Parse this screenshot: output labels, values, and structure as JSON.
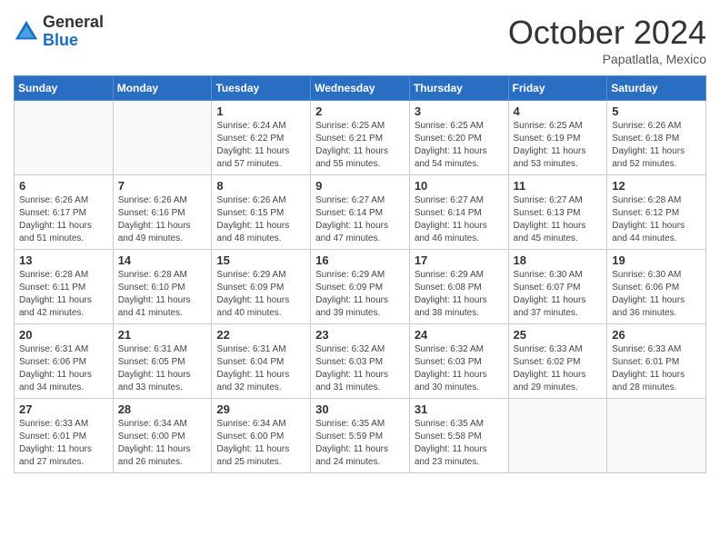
{
  "logo": {
    "general": "General",
    "blue": "Blue"
  },
  "title": {
    "month": "October 2024",
    "location": "Papatlatla, Mexico"
  },
  "headers": [
    "Sunday",
    "Monday",
    "Tuesday",
    "Wednesday",
    "Thursday",
    "Friday",
    "Saturday"
  ],
  "weeks": [
    [
      {
        "day": "",
        "info": ""
      },
      {
        "day": "",
        "info": ""
      },
      {
        "day": "1",
        "info": "Sunrise: 6:24 AM\nSunset: 6:22 PM\nDaylight: 11 hours and 57 minutes."
      },
      {
        "day": "2",
        "info": "Sunrise: 6:25 AM\nSunset: 6:21 PM\nDaylight: 11 hours and 55 minutes."
      },
      {
        "day": "3",
        "info": "Sunrise: 6:25 AM\nSunset: 6:20 PM\nDaylight: 11 hours and 54 minutes."
      },
      {
        "day": "4",
        "info": "Sunrise: 6:25 AM\nSunset: 6:19 PM\nDaylight: 11 hours and 53 minutes."
      },
      {
        "day": "5",
        "info": "Sunrise: 6:26 AM\nSunset: 6:18 PM\nDaylight: 11 hours and 52 minutes."
      }
    ],
    [
      {
        "day": "6",
        "info": "Sunrise: 6:26 AM\nSunset: 6:17 PM\nDaylight: 11 hours and 51 minutes."
      },
      {
        "day": "7",
        "info": "Sunrise: 6:26 AM\nSunset: 6:16 PM\nDaylight: 11 hours and 49 minutes."
      },
      {
        "day": "8",
        "info": "Sunrise: 6:26 AM\nSunset: 6:15 PM\nDaylight: 11 hours and 48 minutes."
      },
      {
        "day": "9",
        "info": "Sunrise: 6:27 AM\nSunset: 6:14 PM\nDaylight: 11 hours and 47 minutes."
      },
      {
        "day": "10",
        "info": "Sunrise: 6:27 AM\nSunset: 6:14 PM\nDaylight: 11 hours and 46 minutes."
      },
      {
        "day": "11",
        "info": "Sunrise: 6:27 AM\nSunset: 6:13 PM\nDaylight: 11 hours and 45 minutes."
      },
      {
        "day": "12",
        "info": "Sunrise: 6:28 AM\nSunset: 6:12 PM\nDaylight: 11 hours and 44 minutes."
      }
    ],
    [
      {
        "day": "13",
        "info": "Sunrise: 6:28 AM\nSunset: 6:11 PM\nDaylight: 11 hours and 42 minutes."
      },
      {
        "day": "14",
        "info": "Sunrise: 6:28 AM\nSunset: 6:10 PM\nDaylight: 11 hours and 41 minutes."
      },
      {
        "day": "15",
        "info": "Sunrise: 6:29 AM\nSunset: 6:09 PM\nDaylight: 11 hours and 40 minutes."
      },
      {
        "day": "16",
        "info": "Sunrise: 6:29 AM\nSunset: 6:09 PM\nDaylight: 11 hours and 39 minutes."
      },
      {
        "day": "17",
        "info": "Sunrise: 6:29 AM\nSunset: 6:08 PM\nDaylight: 11 hours and 38 minutes."
      },
      {
        "day": "18",
        "info": "Sunrise: 6:30 AM\nSunset: 6:07 PM\nDaylight: 11 hours and 37 minutes."
      },
      {
        "day": "19",
        "info": "Sunrise: 6:30 AM\nSunset: 6:06 PM\nDaylight: 11 hours and 36 minutes."
      }
    ],
    [
      {
        "day": "20",
        "info": "Sunrise: 6:31 AM\nSunset: 6:06 PM\nDaylight: 11 hours and 34 minutes."
      },
      {
        "day": "21",
        "info": "Sunrise: 6:31 AM\nSunset: 6:05 PM\nDaylight: 11 hours and 33 minutes."
      },
      {
        "day": "22",
        "info": "Sunrise: 6:31 AM\nSunset: 6:04 PM\nDaylight: 11 hours and 32 minutes."
      },
      {
        "day": "23",
        "info": "Sunrise: 6:32 AM\nSunset: 6:03 PM\nDaylight: 11 hours and 31 minutes."
      },
      {
        "day": "24",
        "info": "Sunrise: 6:32 AM\nSunset: 6:03 PM\nDaylight: 11 hours and 30 minutes."
      },
      {
        "day": "25",
        "info": "Sunrise: 6:33 AM\nSunset: 6:02 PM\nDaylight: 11 hours and 29 minutes."
      },
      {
        "day": "26",
        "info": "Sunrise: 6:33 AM\nSunset: 6:01 PM\nDaylight: 11 hours and 28 minutes."
      }
    ],
    [
      {
        "day": "27",
        "info": "Sunrise: 6:33 AM\nSunset: 6:01 PM\nDaylight: 11 hours and 27 minutes."
      },
      {
        "day": "28",
        "info": "Sunrise: 6:34 AM\nSunset: 6:00 PM\nDaylight: 11 hours and 26 minutes."
      },
      {
        "day": "29",
        "info": "Sunrise: 6:34 AM\nSunset: 6:00 PM\nDaylight: 11 hours and 25 minutes."
      },
      {
        "day": "30",
        "info": "Sunrise: 6:35 AM\nSunset: 5:59 PM\nDaylight: 11 hours and 24 minutes."
      },
      {
        "day": "31",
        "info": "Sunrise: 6:35 AM\nSunset: 5:58 PM\nDaylight: 11 hours and 23 minutes."
      },
      {
        "day": "",
        "info": ""
      },
      {
        "day": "",
        "info": ""
      }
    ]
  ]
}
